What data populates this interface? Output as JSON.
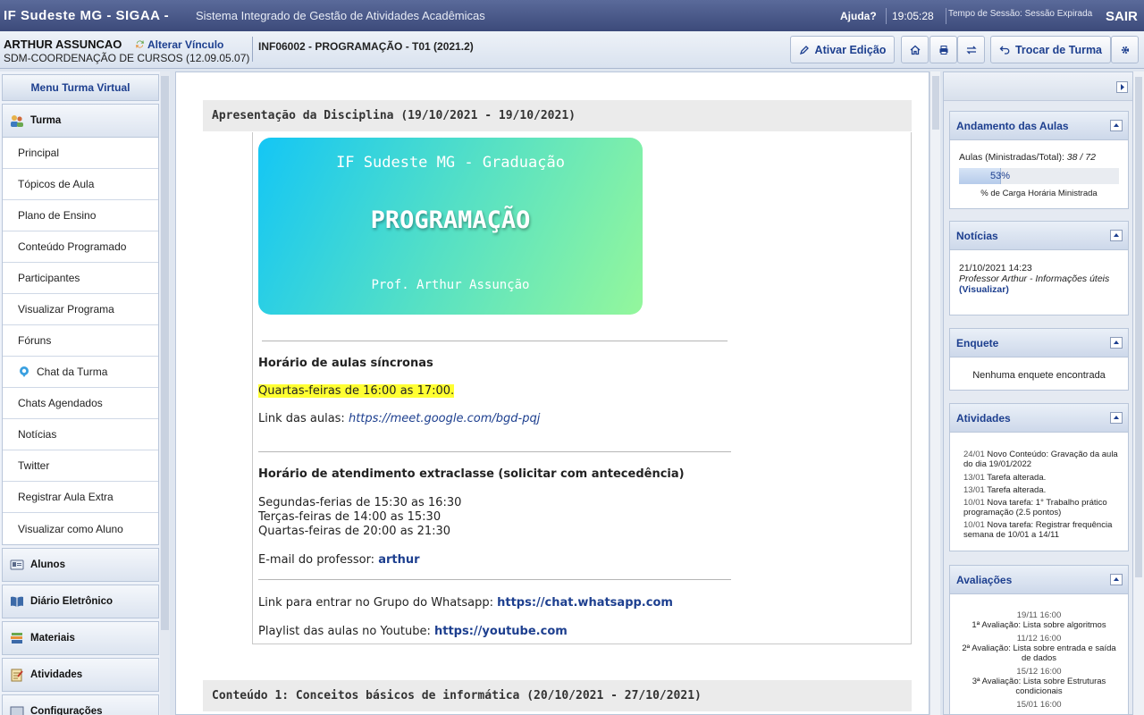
{
  "top": {
    "system": "IF Sudeste MG - SIGAA -",
    "system_desc": "Sistema Integrado de Gestão de Atividades Acadêmicas",
    "help": "Ajuda?",
    "clock": "19:05:28",
    "session": "Tempo de Sessão: Sessão Expirada",
    "logout": "SAIR"
  },
  "header": {
    "user_name": "ARTHUR ASSUNCAO",
    "change_link": "Alterar Vínculo",
    "unit": "SDM-COORDENAÇÃO DE CURSOS (12.09.05.07)",
    "course": "INF06002 - PROGRAMAÇÃO - T01 (2021.2)",
    "edit_btn": "Ativar Edição",
    "change_class_btn": "Trocar de Turma"
  },
  "menu": {
    "title": "Menu Turma Virtual",
    "turma": "Turma",
    "items": [
      "Principal",
      "Tópicos de Aula",
      "Plano de Ensino",
      "Conteúdo Programado",
      "Participantes",
      "Visualizar Programa",
      "Fóruns",
      "Chat da Turma",
      "Chats Agendados",
      "Notícias",
      "Twitter",
      "Registrar Aula Extra",
      "Visualizar como Aluno"
    ],
    "sections": [
      "Alunos",
      "Diário Eletrônico",
      "Materiais",
      "Atividades",
      "Configurações"
    ]
  },
  "main": {
    "section1_title": "Apresentação da Disciplina (19/10/2021 - 19/10/2021)",
    "banner": {
      "line1": "IF Sudeste MG - Graduação",
      "line2": "PROGRAMAÇÃO",
      "line3": "Prof. Arthur Assunção"
    },
    "sync_title": "Horário de aulas síncronas",
    "sync_time": "Quartas-feiras de 16:00 as 17:00.",
    "link_label": "Link das aulas:",
    "link_url": "https://meet.google.com/bgd-pqj",
    "office_title": "Horário de atendimento extraclasse (solicitar com antecedência)",
    "office_lines": [
      "Segundas-ferias de 15:30 as 16:30",
      "Terças-feiras de 14:00 as 15:30",
      "Quartas-feiras de 20:00 as 21:30"
    ],
    "email_label": "E-mail do professor:",
    "email_value": "arthur",
    "whatsapp_label": "Link para entrar no Grupo do Whatsapp:",
    "whatsapp_url": "https://chat.whatsapp.com",
    "youtube_label": "Playlist das aulas no Youtube:",
    "youtube_url": "https://youtube.com",
    "section2_title": "Conteúdo 1: Conceitos básicos de informática (20/10/2021 - 27/10/2021)"
  },
  "right": {
    "progress": {
      "title": "Andamento das Aulas",
      "label": "Aulas (Ministradas/Total):",
      "value": "38 / 72",
      "percent_text": "53%",
      "percent": 53,
      "caption": "% de Carga Horária Ministrada"
    },
    "news": {
      "title": "Notícias",
      "date": "21/10/2021 14:23",
      "text": "Professor Arthur - Informações úteis",
      "link": "(Visualizar)"
    },
    "poll": {
      "title": "Enquete",
      "empty": "Nenhuma enquete encontrada"
    },
    "activities": {
      "title": "Atividades",
      "items": [
        {
          "date": "24/01",
          "text": "Novo Conteúdo: Gravação da aula do dia 19/01/2022"
        },
        {
          "date": "13/01",
          "text": "Tarefa alterada."
        },
        {
          "date": "13/01",
          "text": "Tarefa alterada."
        },
        {
          "date": "10/01",
          "text": "Nova tarefa: 1° Trabalho prático programação (2.5 pontos)"
        },
        {
          "date": "10/01",
          "text": "Nova tarefa: Registrar frequência semana de 10/01 a 14/11"
        }
      ]
    },
    "evaluations": {
      "title": "Avaliações",
      "items": [
        {
          "date": "19/11 16:00",
          "text": "1ª Avaliação: Lista sobre algoritmos"
        },
        {
          "date": "11/12 16:00",
          "text": "2ª Avaliação: Lista sobre entrada e saída de dados"
        },
        {
          "date": "15/12 16:00",
          "text": "3ª Avaliação: Lista sobre Estruturas condicionais"
        },
        {
          "date": "15/01 16:00",
          "text": ""
        }
      ]
    }
  }
}
